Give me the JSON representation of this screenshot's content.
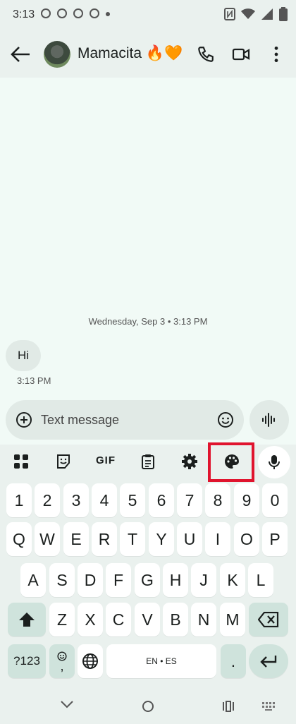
{
  "status": {
    "time": "3:13"
  },
  "header": {
    "contact_name": "Mamacita 🔥🧡"
  },
  "chat": {
    "date_label": "Wednesday, Sep 3 • 3:13 PM",
    "messages": [
      {
        "text": "Hi",
        "time": "3:13 PM"
      }
    ]
  },
  "composer": {
    "placeholder": "Text message"
  },
  "keyboard": {
    "row_numbers": [
      "1",
      "2",
      "3",
      "4",
      "5",
      "6",
      "7",
      "8",
      "9",
      "0"
    ],
    "row_q": [
      "Q",
      "W",
      "E",
      "R",
      "T",
      "Y",
      "U",
      "I",
      "O",
      "P"
    ],
    "row_a": [
      "A",
      "S",
      "D",
      "F",
      "G",
      "H",
      "J",
      "K",
      "L"
    ],
    "row_z": [
      "Z",
      "X",
      "C",
      "V",
      "B",
      "N",
      "M"
    ],
    "symbols_label": "?123",
    "comma_label": ",",
    "space_label": "EN • ES",
    "period_label": ".",
    "gif_label": "GIF"
  },
  "colors": {
    "highlight": "#e0142e",
    "accent_key": "#cfe3dc"
  }
}
